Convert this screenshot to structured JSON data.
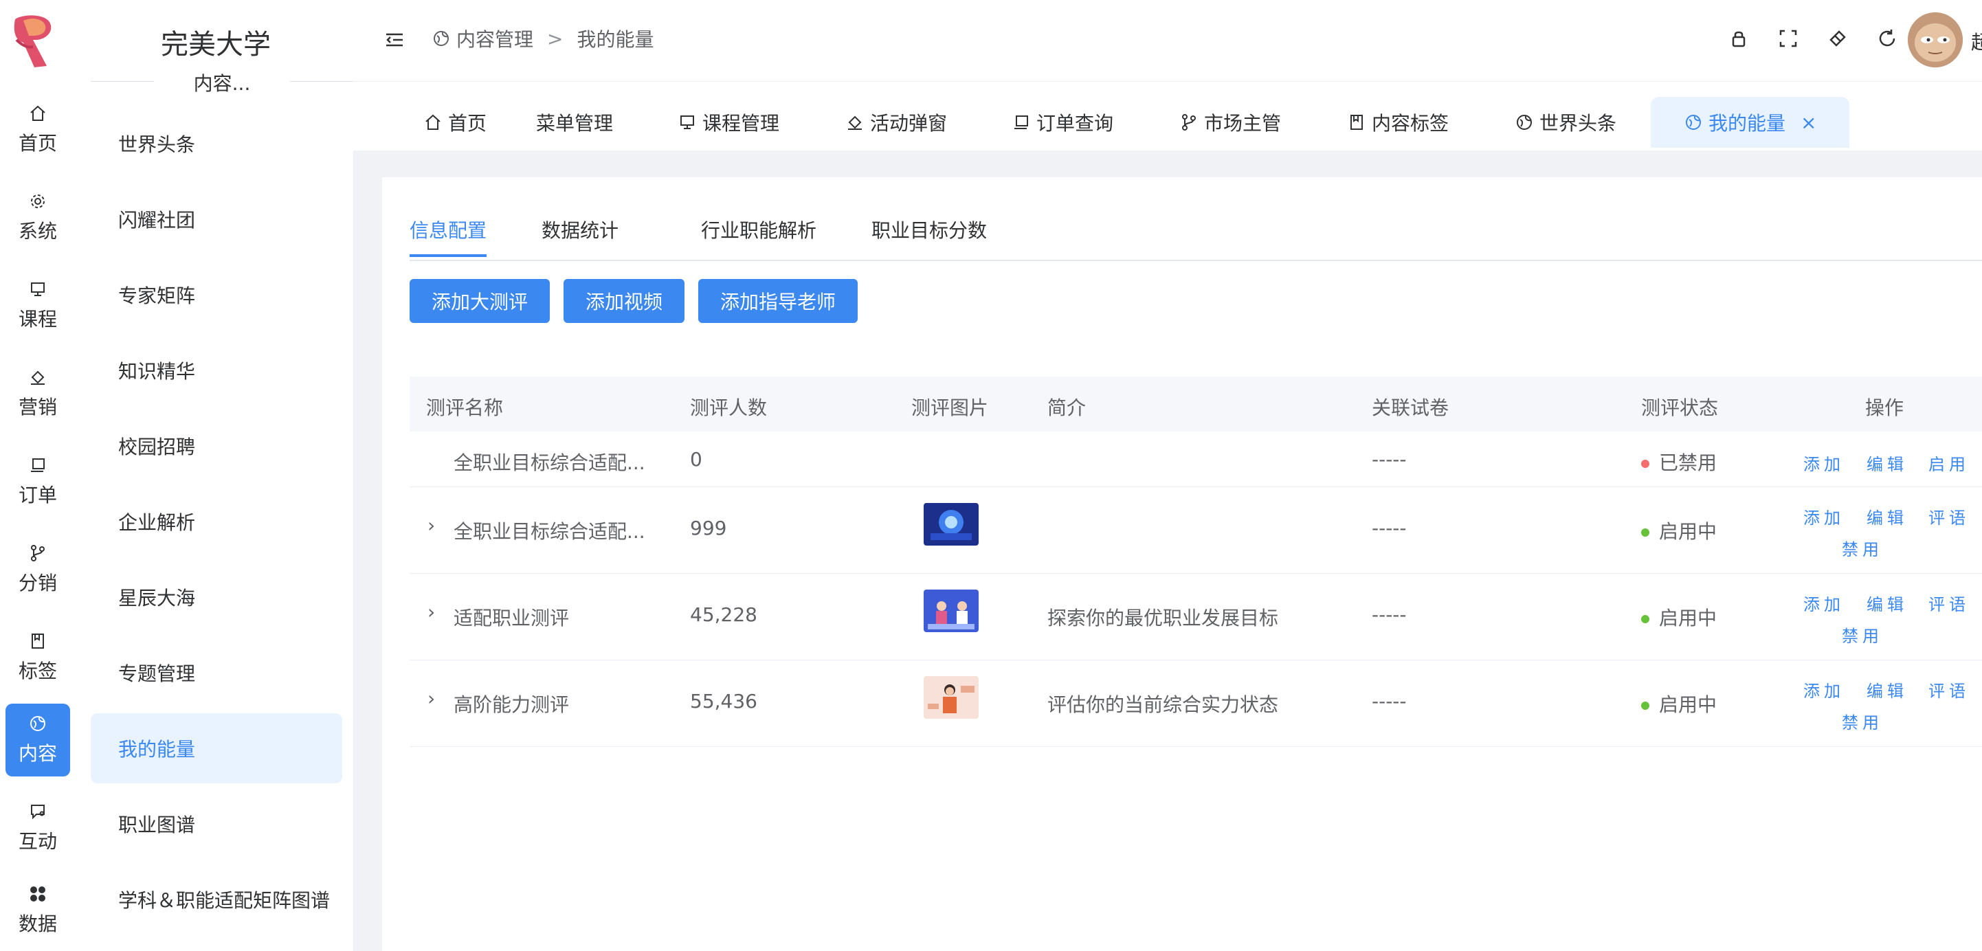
{
  "org": {
    "name": "完美大学"
  },
  "rail": {
    "items": [
      {
        "label": "首页",
        "icon": "home-icon"
      },
      {
        "label": "系统",
        "icon": "gear-icon"
      },
      {
        "label": "课程",
        "icon": "monitor-icon"
      },
      {
        "label": "营销",
        "icon": "megaphone-icon"
      },
      {
        "label": "订单",
        "icon": "laptop-icon"
      },
      {
        "label": "分销",
        "icon": "branch-icon"
      },
      {
        "label": "标签",
        "icon": "book-icon"
      },
      {
        "label": "内容",
        "icon": "globe-icon",
        "active": true
      },
      {
        "label": "互动",
        "icon": "chat-icon"
      },
      {
        "label": "数据",
        "icon": "grid-icon"
      }
    ]
  },
  "submenu": {
    "section_label": "内容...",
    "items": [
      {
        "label": "世界头条"
      },
      {
        "label": "闪耀社团"
      },
      {
        "label": "专家矩阵"
      },
      {
        "label": "知识精华"
      },
      {
        "label": "校园招聘"
      },
      {
        "label": "企业解析"
      },
      {
        "label": "星辰大海"
      },
      {
        "label": "专题管理"
      },
      {
        "label": "我的能量",
        "active": true
      },
      {
        "label": "职业图谱"
      },
      {
        "label": "学科＆职能适配矩阵图谱"
      }
    ]
  },
  "breadcrumb": {
    "parent": "内容管理",
    "separator": ">",
    "current": "我的能量"
  },
  "header_icons": [
    "lock-icon",
    "fullscreen-icon",
    "clear-icon",
    "refresh-icon"
  ],
  "user": {
    "name_partial": "超"
  },
  "tabs": [
    {
      "label": "首页",
      "icon": "home-icon"
    },
    {
      "label": "菜单管理",
      "icon": ""
    },
    {
      "label": "课程管理",
      "icon": "monitor-icon"
    },
    {
      "label": "活动弹窗",
      "icon": "megaphone-icon"
    },
    {
      "label": "订单查询",
      "icon": "laptop-icon"
    },
    {
      "label": "市场主管",
      "icon": "branch-icon"
    },
    {
      "label": "内容标签",
      "icon": "book-icon"
    },
    {
      "label": "世界头条",
      "icon": "globe-icon"
    },
    {
      "label": "我的能量",
      "icon": "globe-icon",
      "active": true,
      "close": "×"
    }
  ],
  "subtabs": [
    {
      "label": "信息配置",
      "active": true
    },
    {
      "label": "数据统计"
    },
    {
      "label": "行业职能解析"
    },
    {
      "label": "职业目标分数"
    }
  ],
  "actions": [
    {
      "label": "添加大测评"
    },
    {
      "label": "添加视频"
    },
    {
      "label": "添加指导老师"
    }
  ],
  "table": {
    "columns": [
      "测评名称",
      "测评人数",
      "测评图片",
      "简介",
      "关联试卷",
      "测评状态",
      "操作"
    ],
    "rows": [
      {
        "name": "全职业目标综合适配...",
        "count": "0",
        "image": "",
        "intro": "",
        "paper": "-----",
        "status": "已禁用",
        "status_color": "#f56c6c",
        "expandable": false,
        "ops": [
          "添加",
          "编辑",
          "启用"
        ]
      },
      {
        "name": "全职业目标综合适配...",
        "count": "999",
        "image": "thumb-blue",
        "intro": "",
        "paper": "-----",
        "status": "启用中",
        "status_color": "#67c23a",
        "expandable": true,
        "expand_icon": "›",
        "ops": [
          "添加",
          "编辑",
          "评语",
          "禁用"
        ]
      },
      {
        "name": "适配职业测评",
        "count": "45,228",
        "image": "thumb-people",
        "intro": "探索你的最优职业发展目标",
        "paper": "-----",
        "status": "启用中",
        "status_color": "#67c23a",
        "expandable": true,
        "expand_icon": "›",
        "ops": [
          "添加",
          "编辑",
          "评语",
          "禁用"
        ]
      },
      {
        "name": "高阶能力测评",
        "count": "55,436",
        "image": "thumb-woman",
        "intro": "评估你的当前综合实力状态",
        "paper": "-----",
        "status": "启用中",
        "status_color": "#67c23a",
        "expandable": true,
        "expand_icon": "›",
        "ops": [
          "添加",
          "编辑",
          "评语",
          "禁用"
        ]
      }
    ]
  },
  "colors": {
    "accent": "#3b88f0",
    "enabled": "#67c23a",
    "disabled": "#f56c6c"
  }
}
